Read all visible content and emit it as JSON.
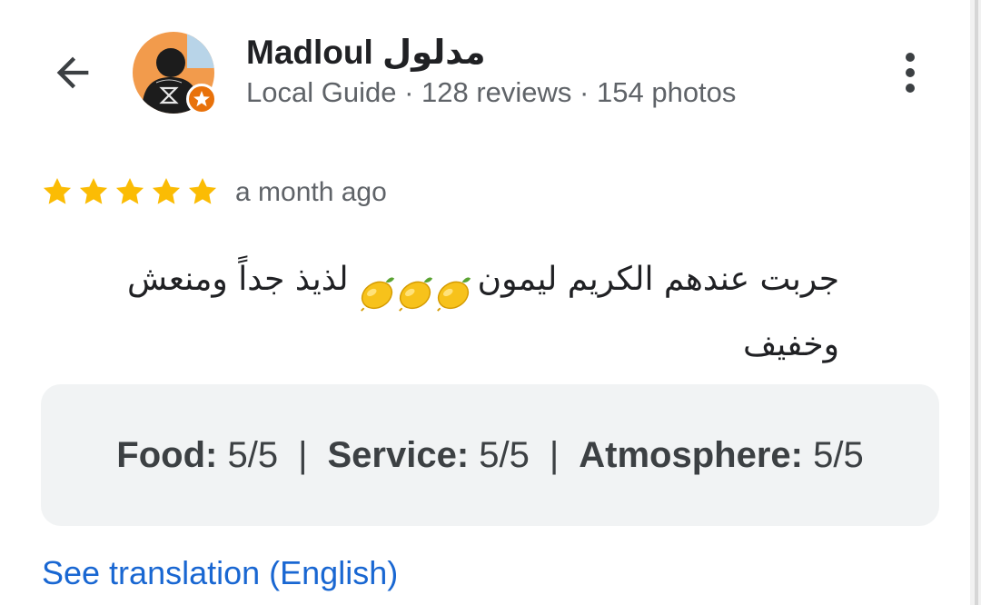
{
  "reviewer": {
    "name": "Madloul مدلول",
    "level": "Local Guide",
    "reviews_count": "128 reviews",
    "photos_count": "154 photos",
    "separator": " · "
  },
  "review": {
    "rating": 5,
    "rating_max": 5,
    "time_ago": "a month ago",
    "text_line1_a": "جربت عندهم الكريم ليمون",
    "text_line1_b": "لذيذ جداً ومنعش",
    "text_line2": "وخفيف",
    "emoji_count": 3
  },
  "ratings": {
    "food_label": "Food:",
    "food_value": "5/5",
    "service_label": "Service:",
    "service_value": "5/5",
    "atmosphere_label": "Atmosphere:",
    "atmosphere_value": "5/5",
    "divider": "|"
  },
  "actions": {
    "see_translation": "See translation (English)"
  },
  "icons": {
    "back": "arrow-back-icon",
    "more": "more-vert-icon",
    "star": "star-icon",
    "badge": "local-guide-badge-icon",
    "lemon": "lemon-emoji-icon"
  },
  "colors": {
    "star": "#fbbc04",
    "badge": "#e8710a",
    "link": "#1967d2",
    "card_bg": "#f1f3f4",
    "avatar_bg": "#f29b4c"
  }
}
